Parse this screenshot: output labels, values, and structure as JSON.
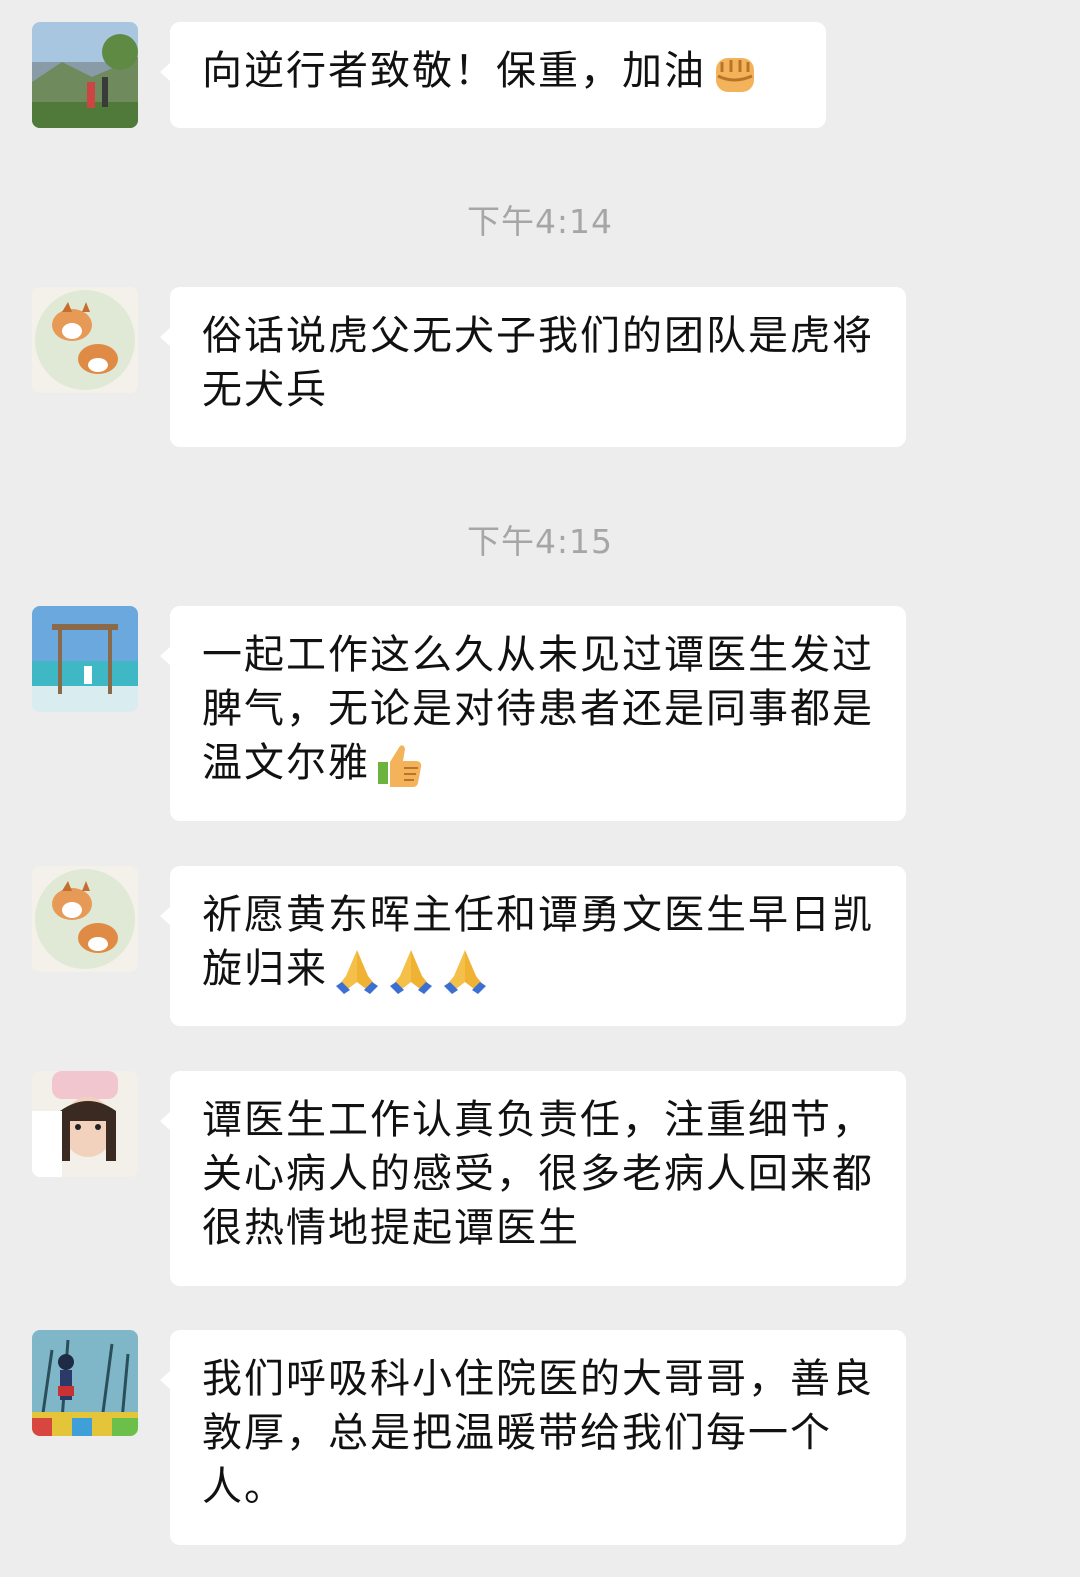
{
  "messages": [
    {
      "text": "向逆行者致敬！保重，加油",
      "emoji": [
        "fist-icon"
      ]
    },
    {
      "text": "俗话说虎父无犬子我们的团队是虎将无犬兵",
      "emoji": []
    },
    {
      "text": "一起工作这么久从未见过谭医生发过脾气，无论是对待患者还是同事都是温文尔雅",
      "emoji": [
        "thumbs-up-icon"
      ]
    },
    {
      "text": "祈愿黄东晖主任和谭勇文医生早日凯旋归来",
      "emoji": [
        "pray-icon",
        "pray-icon",
        "pray-icon"
      ]
    },
    {
      "text": "谭医生工作认真负责任，注重细节，关心病人的感受，很多老病人回来都很热情地提起谭医生",
      "emoji": []
    },
    {
      "text": "我们呼吸科小住院医的大哥哥，善良敦厚，总是把温暖带给我们每一个人。",
      "emoji": []
    }
  ],
  "timestamps": {
    "t1": "下午4:14",
    "t2": "下午4:15"
  },
  "colors": {
    "background": "#ededed",
    "bubble": "#ffffff",
    "timestamp": "#a6a6a6"
  }
}
